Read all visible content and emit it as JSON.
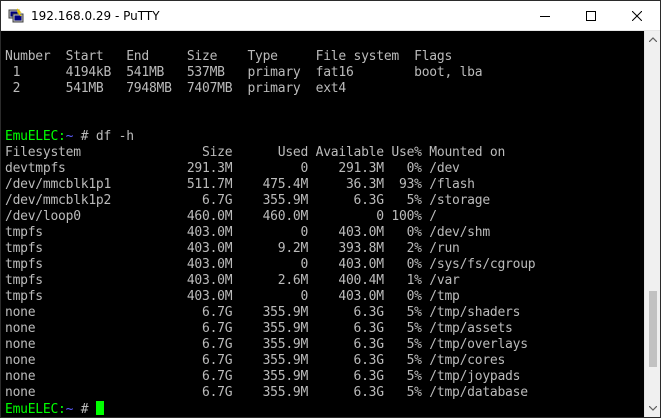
{
  "window": {
    "title": "192.168.0.29 - PuTTY",
    "icon": "putty-terminal-icon",
    "controls": [
      "minimize-icon",
      "maximize-icon",
      "close-icon"
    ]
  },
  "terminal": {
    "colors": {
      "background": "#000000",
      "text": "#bbbbbb",
      "prompt_host": "#00ff00",
      "prompt_tilde": "#5c5cff",
      "cursor": "#00ff00"
    },
    "lines": [
      "",
      "Number  Start   End     Size    Type     File system  Flags",
      " 1      4194kB  541MB   537MB   primary  fat16        boot, lba",
      " 2      541MB   7948MB  7407MB  primary  ext4",
      "",
      "",
      "Filesystem                Size      Used Available Use% Mounted on",
      "devtmpfs                291.3M         0    291.3M   0% /dev",
      "/dev/mmcblk1p1          511.7M    475.4M     36.3M  93% /flash",
      "/dev/mmcblk1p2            6.7G    355.9M      6.3G   5% /storage",
      "/dev/loop0              460.0M    460.0M         0 100% /",
      "tmpfs                   403.0M         0    403.0M   0% /dev/shm",
      "tmpfs                   403.0M      9.2M    393.8M   2% /run",
      "tmpfs                   403.0M         0    403.0M   0% /sys/fs/cgroup",
      "tmpfs                   403.0M      2.6M    400.4M   1% /var",
      "tmpfs                   403.0M         0    403.0M   0% /tmp",
      "none                      6.7G    355.9M      6.3G   5% /tmp/shaders",
      "none                      6.7G    355.9M      6.3G   5% /tmp/assets",
      "none                      6.7G    355.9M      6.3G   5% /tmp/overlays",
      "none                      6.7G    355.9M      6.3G   5% /tmp/cores",
      "none                      6.7G    355.9M      6.3G   5% /tmp/joypads",
      "none                      6.7G    355.9M      6.3G   5% /tmp/database"
    ],
    "prompt_1": {
      "host": "EmuELEC:",
      "tilde": "~",
      "rest": " # df -h"
    },
    "prompt_2": {
      "host": "EmuELEC:",
      "tilde": "~",
      "rest": " # "
    }
  },
  "scrollbar": {
    "position_fraction": 0.88
  }
}
